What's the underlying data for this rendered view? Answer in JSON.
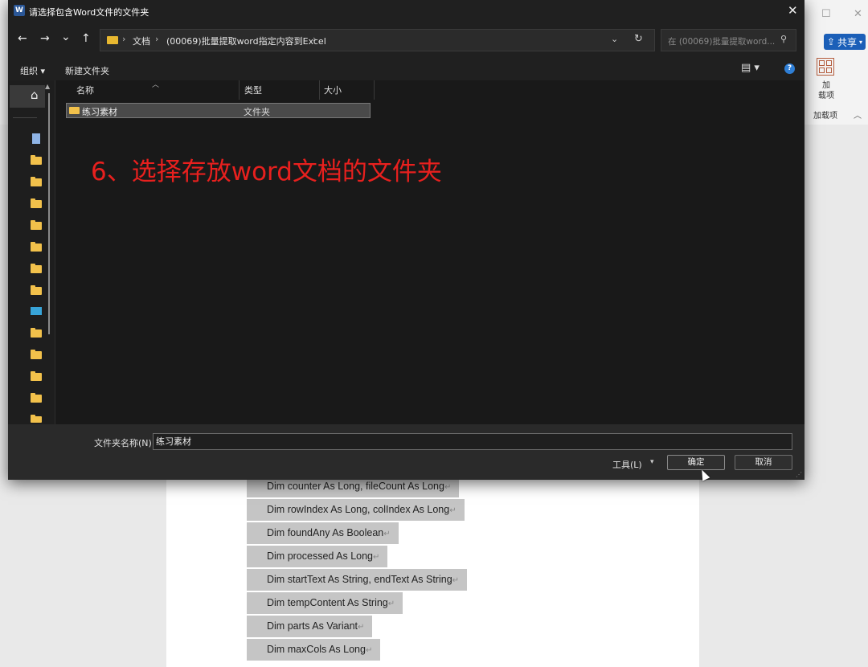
{
  "dialog": {
    "title": "请选择包含Word文件的文件夹",
    "close": "✕",
    "nav": {
      "back": "←",
      "forward": "→",
      "recent": "⌄",
      "up": "↑"
    },
    "breadcrumb": [
      "文档",
      "(00069)批量提取word指定内容到Excel"
    ],
    "search_placeholder": "在 (00069)批量提取word...",
    "toolbar": {
      "organize": "组织 ▾",
      "new_folder": "新建文件夹"
    },
    "columns": [
      "名称",
      "类型",
      "大小"
    ],
    "rows": [
      {
        "name": "练习素材",
        "type": "文件夹",
        "selected": true
      }
    ],
    "folder_name_label": "文件夹名称(N):",
    "folder_name_value": "练习素材",
    "tools_label": "工具(L)",
    "ok_label": "确定",
    "cancel_label": "取消"
  },
  "annotation": "6、选择存放word文档的文件夹",
  "word": {
    "share_label": "共享",
    "addins_label": "加\n载项",
    "group_label": "加载项",
    "code_lines": [
      "Dim counter As Long, fileCount As Long",
      "Dim rowIndex As Long, colIndex As Long",
      "Dim foundAny As Boolean",
      "Dim processed As Long",
      "Dim startText As String, endText As String",
      "Dim tempContent As String",
      "Dim parts As Variant",
      "Dim maxCols As Long"
    ]
  },
  "colors": {
    "annotation": "#e8201e",
    "folder": "#f2c14b",
    "accent": "#1b5fb8"
  }
}
